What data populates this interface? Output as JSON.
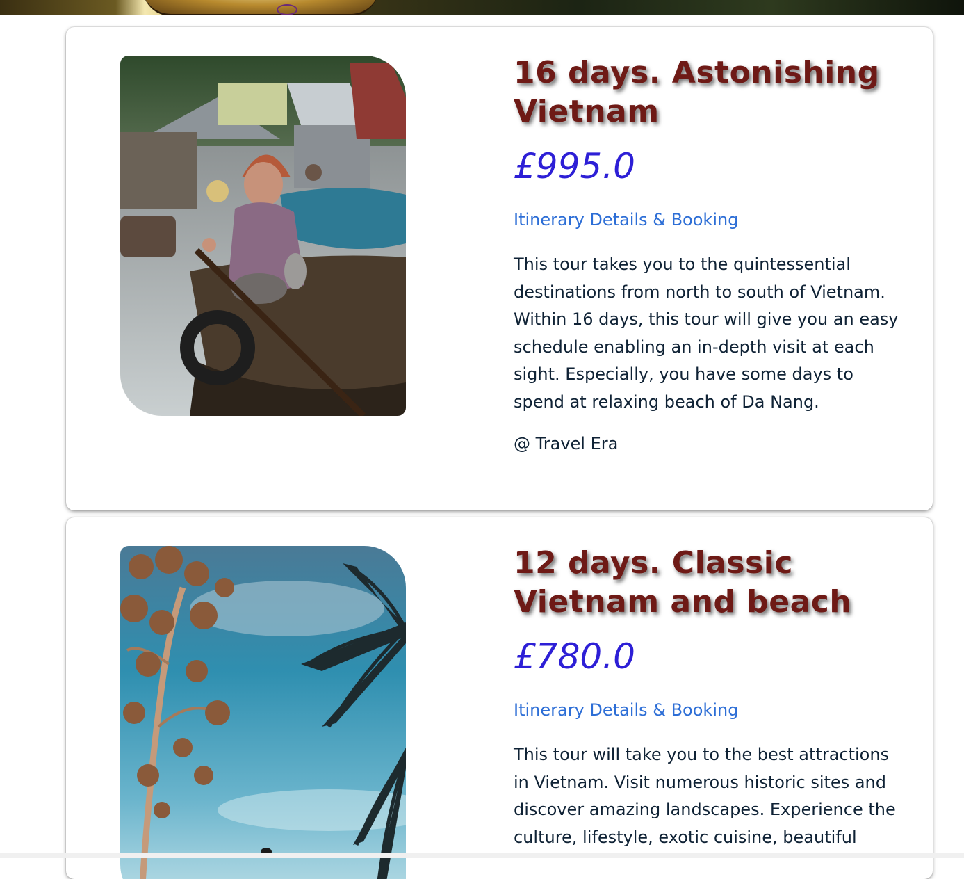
{
  "colors": {
    "title": "#6e1a16",
    "price": "#2d1fd6",
    "link": "#2d6ed6",
    "text": "#0f2235",
    "card_background": "#ffffff"
  },
  "tours": [
    {
      "title": "16 days. Astonishing Vietnam",
      "price": "£995.0",
      "link_label": "Itinerary Details & Booking",
      "description": "This tour takes you to the quintessential destinations from north to south of Vietnam. Within 16 days, this tour will give you an easy schedule enabling an in-depth visit at each sight. Especially, you have some days to spend at relaxing beach of Da Nang.",
      "credit": "@ Travel Era"
    },
    {
      "title": "12 days. Classic Vietnam and beach",
      "price": "£780.0",
      "link_label": "Itinerary Details & Booking",
      "description": "This tour will take you to the best attractions in Vietnam. Visit numerous historic sites and discover amazing landscapes. Experience the culture, lifestyle, exotic cuisine, beautiful"
    }
  ]
}
